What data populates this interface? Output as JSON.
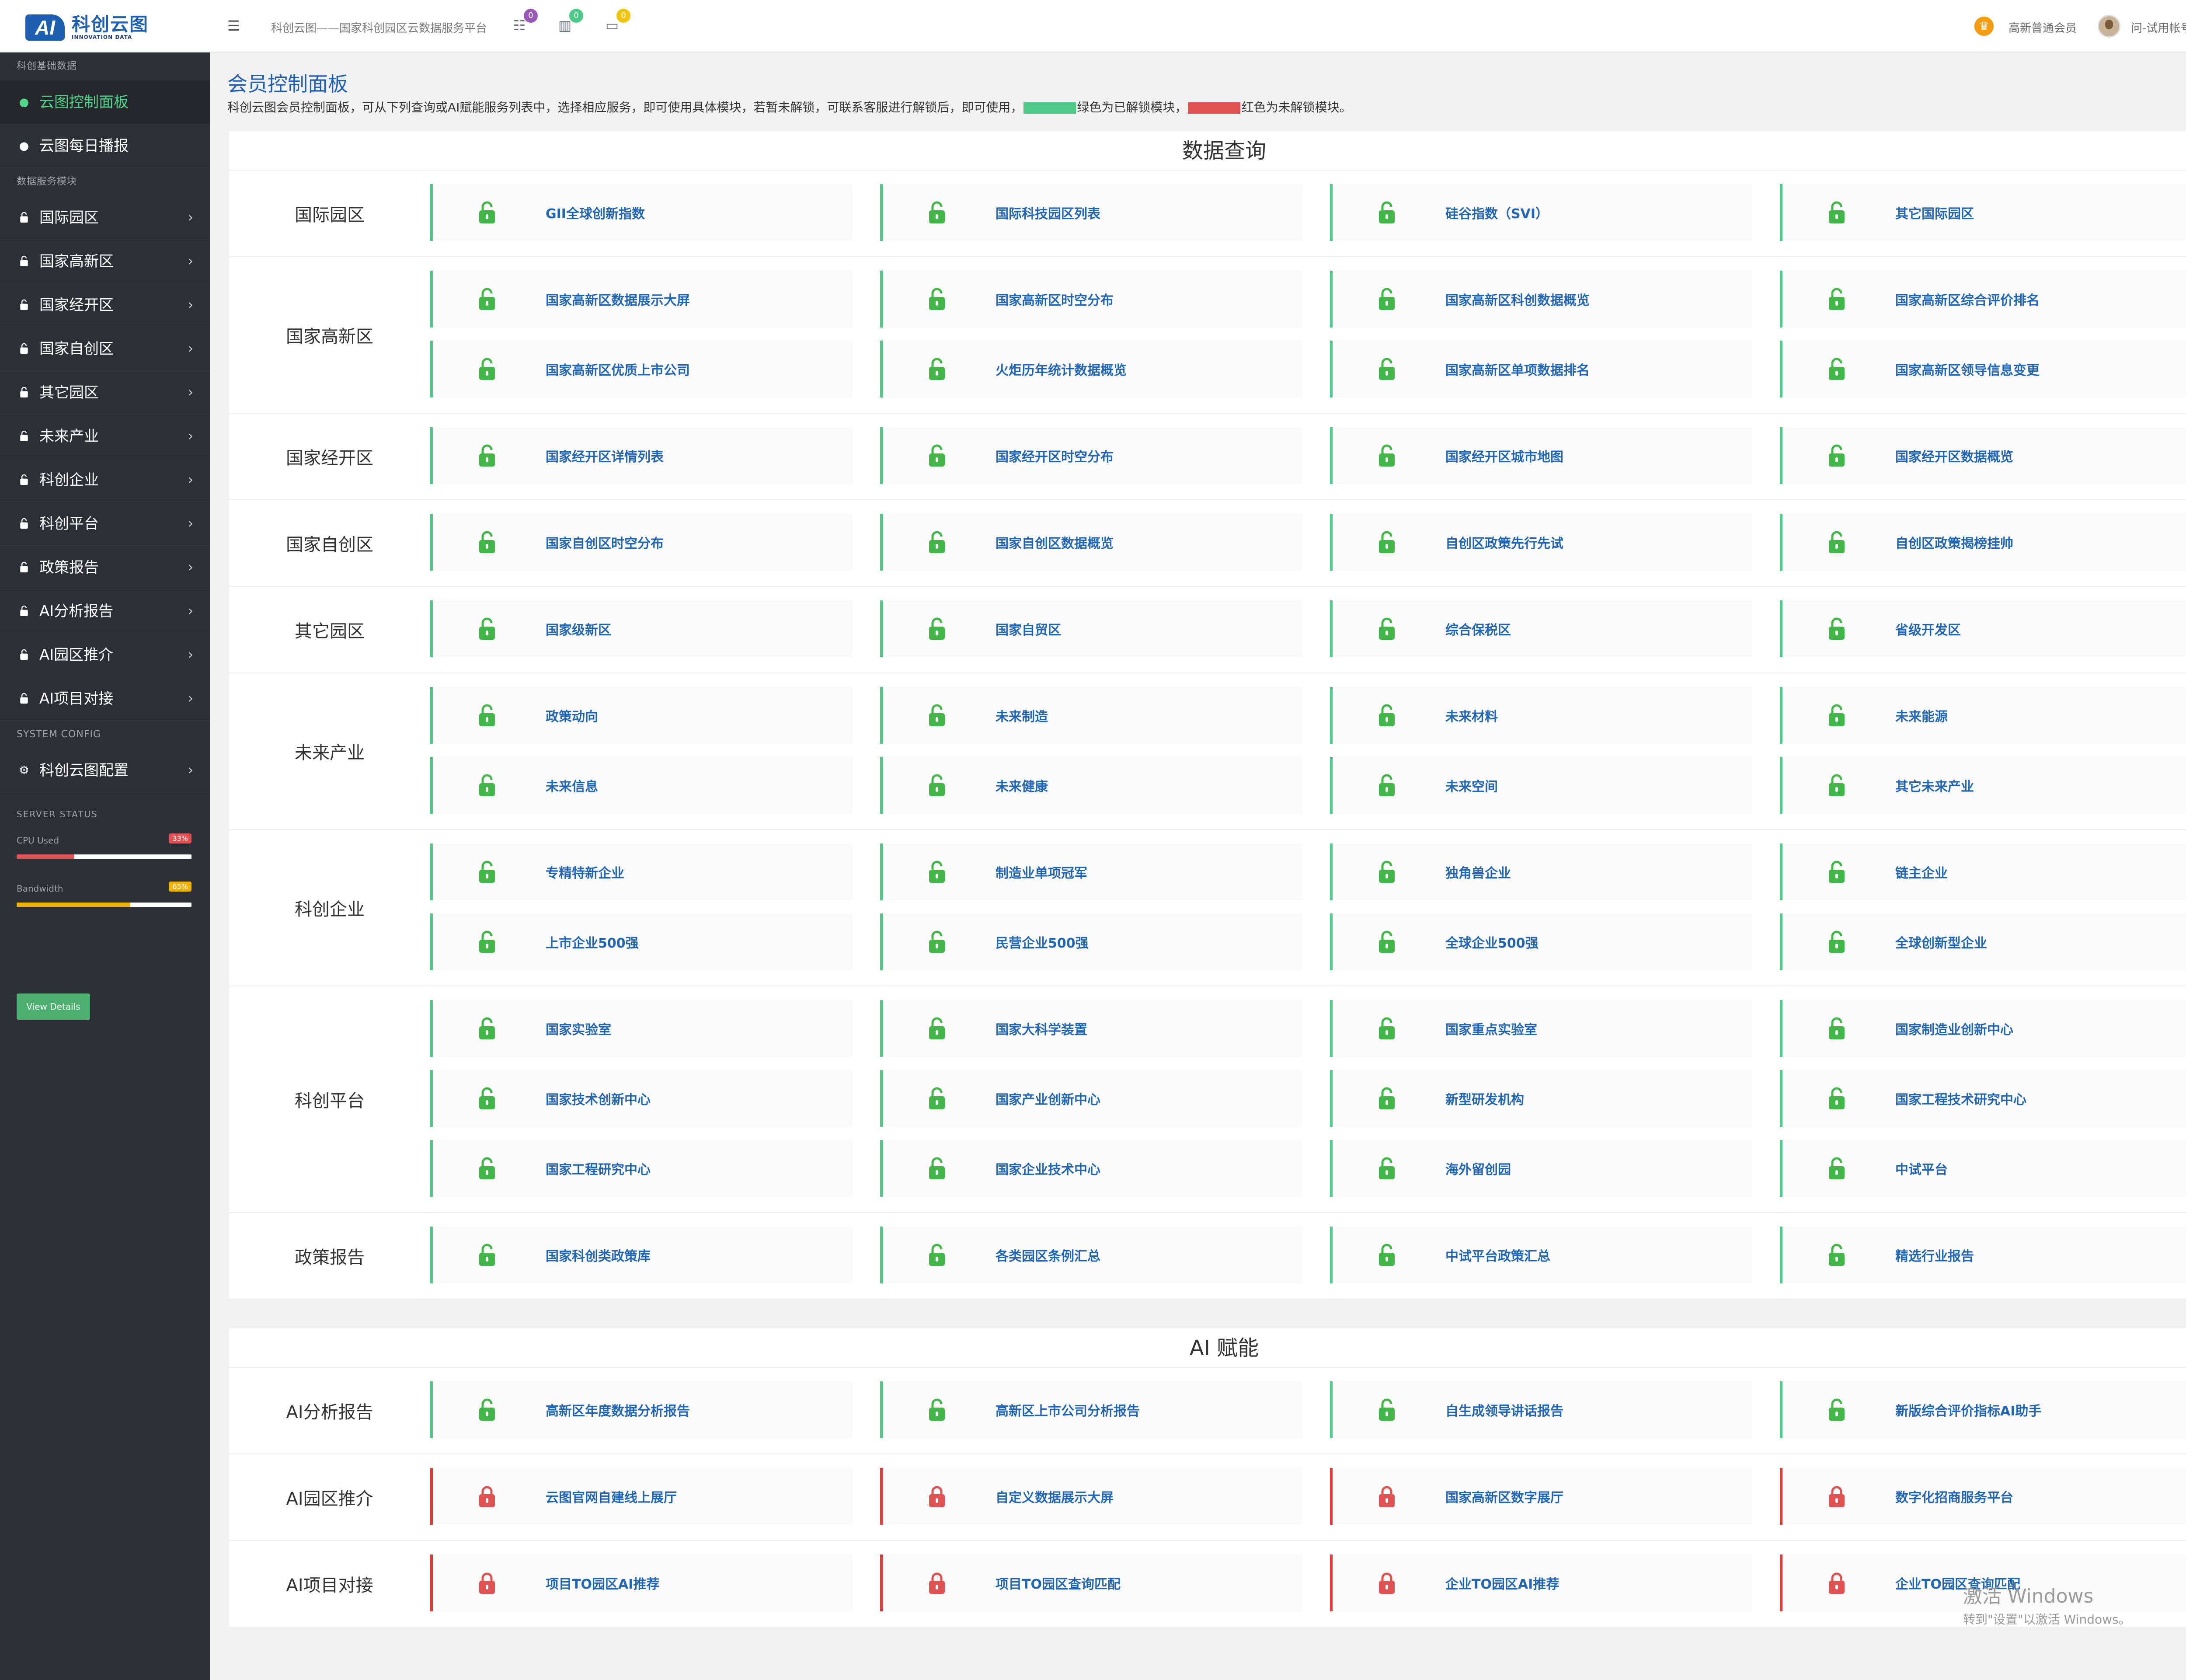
{
  "header": {
    "logo_cn": "科创云图",
    "logo_en": "INNOVATION DATA",
    "title": "科创云图——国家科创园区云数据服务平台",
    "badges": [
      {
        "icon": "list-icon",
        "count": "0",
        "color": "#9b59b6"
      },
      {
        "icon": "bar-chart-icon",
        "count": "0",
        "color": "#4fc987"
      },
      {
        "icon": "laptop-icon",
        "count": "0",
        "color": "#f1c40f"
      }
    ],
    "member_label": "高新普通会员",
    "user_label": "问-试用帐号"
  },
  "sidebar": {
    "section1": "科创基础数据",
    "top_items": [
      {
        "label": "云图控制面板",
        "icon": "user-icon",
        "active": true
      },
      {
        "label": "云图每日播报",
        "icon": "user-icon",
        "active": false
      }
    ],
    "section2": "数据服务模块",
    "module_items": [
      {
        "label": "国际园区"
      },
      {
        "label": "国家高新区"
      },
      {
        "label": "国家经开区"
      },
      {
        "label": "国家自创区"
      },
      {
        "label": "其它园区"
      },
      {
        "label": "未来产业"
      },
      {
        "label": "科创企业"
      },
      {
        "label": "科创平台"
      },
      {
        "label": "政策报告"
      },
      {
        "label": "AI分析报告"
      },
      {
        "label": "AI园区推介"
      },
      {
        "label": "AI项目对接"
      }
    ],
    "section3": "SYSTEM CONFIG",
    "config_item": {
      "label": "科创云图配置",
      "icon": "gears-icon"
    },
    "server_status": {
      "title": "SERVER STATUS",
      "cpu": {
        "label": "CPU Used",
        "percent": "33%",
        "value": 33,
        "color": "#e05252"
      },
      "bandwidth": {
        "label": "Bandwidth",
        "percent": "65%",
        "value": 65,
        "color": "#f0b400"
      },
      "button": "View Details"
    }
  },
  "main": {
    "title": "会员控制面板",
    "desc_prefix": "科创云图会员控制面板，可从下列查询或AI赋能服务列表中，选择相应服务，即可使用具体模块，若暂未解锁，可联系客服进行解锁后，即可使用，",
    "desc_green": "绿色为已解锁模块，",
    "desc_red": "红色为未解锁模块。",
    "colors": {
      "unlocked": "#4fc987",
      "locked": "#e05252",
      "link": "#2266b3"
    }
  },
  "query_panel": {
    "title": "数据查询",
    "rows": [
      {
        "label": "国际园区",
        "cards": [
          {
            "label": "GII全球创新指数",
            "locked": false
          },
          {
            "label": "国际科技园区列表",
            "locked": false
          },
          {
            "label": "硅谷指数（SVI）",
            "locked": false
          },
          {
            "label": "其它国际园区",
            "locked": false
          }
        ]
      },
      {
        "label": "国家高新区",
        "cards": [
          {
            "label": "国家高新区数据展示大屏",
            "locked": false
          },
          {
            "label": "国家高新区时空分布",
            "locked": false
          },
          {
            "label": "国家高新区科创数据概览",
            "locked": false
          },
          {
            "label": "国家高新区综合评价排名",
            "locked": false
          },
          {
            "label": "国家高新区优质上市公司",
            "locked": false
          },
          {
            "label": "火炬历年统计数据概览",
            "locked": false
          },
          {
            "label": "国家高新区单项数据排名",
            "locked": false
          },
          {
            "label": "国家高新区领导信息变更",
            "locked": false
          }
        ]
      },
      {
        "label": "国家经开区",
        "cards": [
          {
            "label": "国家经开区详情列表",
            "locked": false
          },
          {
            "label": "国家经开区时空分布",
            "locked": false
          },
          {
            "label": "国家经开区城市地图",
            "locked": false
          },
          {
            "label": "国家经开区数据概览",
            "locked": false
          }
        ]
      },
      {
        "label": "国家自创区",
        "cards": [
          {
            "label": "国家自创区时空分布",
            "locked": false
          },
          {
            "label": "国家自创区数据概览",
            "locked": false
          },
          {
            "label": "自创区政策先行先试",
            "locked": false
          },
          {
            "label": "自创区政策揭榜挂帅",
            "locked": false
          }
        ]
      },
      {
        "label": "其它园区",
        "cards": [
          {
            "label": "国家级新区",
            "locked": false
          },
          {
            "label": "国家自贸区",
            "locked": false
          },
          {
            "label": "综合保税区",
            "locked": false
          },
          {
            "label": "省级开发区",
            "locked": false
          }
        ]
      },
      {
        "label": "未来产业",
        "cards": [
          {
            "label": "政策动向",
            "locked": false
          },
          {
            "label": "未来制造",
            "locked": false
          },
          {
            "label": "未来材料",
            "locked": false
          },
          {
            "label": "未来能源",
            "locked": false
          },
          {
            "label": "未来信息",
            "locked": false
          },
          {
            "label": "未来健康",
            "locked": false
          },
          {
            "label": "未来空间",
            "locked": false
          },
          {
            "label": "其它未来产业",
            "locked": false
          }
        ]
      },
      {
        "label": "科创企业",
        "cards": [
          {
            "label": "专精特新企业",
            "locked": false
          },
          {
            "label": "制造业单项冠军",
            "locked": false
          },
          {
            "label": "独角兽企业",
            "locked": false
          },
          {
            "label": "链主企业",
            "locked": false
          },
          {
            "label": "上市企业500强",
            "locked": false
          },
          {
            "label": "民营企业500强",
            "locked": false
          },
          {
            "label": "全球企业500强",
            "locked": false
          },
          {
            "label": "全球创新型企业",
            "locked": false
          }
        ]
      },
      {
        "label": "科创平台",
        "cards": [
          {
            "label": "国家实验室",
            "locked": false
          },
          {
            "label": "国家大科学装置",
            "locked": false
          },
          {
            "label": "国家重点实验室",
            "locked": false
          },
          {
            "label": "国家制造业创新中心",
            "locked": false
          },
          {
            "label": "国家技术创新中心",
            "locked": false
          },
          {
            "label": "国家产业创新中心",
            "locked": false
          },
          {
            "label": "新型研发机构",
            "locked": false
          },
          {
            "label": "国家工程技术研究中心",
            "locked": false
          },
          {
            "label": "国家工程研究中心",
            "locked": false
          },
          {
            "label": "国家企业技术中心",
            "locked": false
          },
          {
            "label": "海外留创园",
            "locked": false
          },
          {
            "label": "中试平台",
            "locked": false
          }
        ]
      },
      {
        "label": "政策报告",
        "cards": [
          {
            "label": "国家科创类政策库",
            "locked": false
          },
          {
            "label": "各类园区条例汇总",
            "locked": false
          },
          {
            "label": "中试平台政策汇总",
            "locked": false
          },
          {
            "label": "精选行业报告",
            "locked": false
          }
        ]
      }
    ]
  },
  "ai_panel": {
    "title": "AI 赋能",
    "rows": [
      {
        "label": "AI分析报告",
        "cards": [
          {
            "label": "高新区年度数据分析报告",
            "locked": false
          },
          {
            "label": "高新区上市公司分析报告",
            "locked": false
          },
          {
            "label": "自生成领导讲话报告",
            "locked": false
          },
          {
            "label": "新版综合评价指标AI助手",
            "locked": false
          }
        ]
      },
      {
        "label": "AI园区推介",
        "cards": [
          {
            "label": "云图官网自建线上展厅",
            "locked": true
          },
          {
            "label": "自定义数据展示大屏",
            "locked": true
          },
          {
            "label": "国家高新区数字展厅",
            "locked": true
          },
          {
            "label": "数字化招商服务平台",
            "locked": true
          }
        ]
      },
      {
        "label": "AI项目对接",
        "cards": [
          {
            "label": "项目TO园区AI推荐",
            "locked": true
          },
          {
            "label": "项目TO园区查询匹配",
            "locked": true
          },
          {
            "label": "企业TO园区AI推荐",
            "locked": true
          },
          {
            "label": "企业TO园区查询匹配",
            "locked": true
          }
        ]
      }
    ]
  },
  "watermark": {
    "line1": "激活 Windows",
    "line2": "转到\"设置\"以激活 Windows。"
  }
}
